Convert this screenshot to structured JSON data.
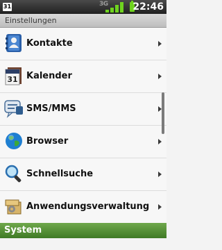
{
  "status_bar": {
    "calendar_day": "31",
    "network_type": "3G",
    "time": "22:46",
    "battery_color": "#6fd31f",
    "signal_color": "#6fd31f"
  },
  "header": {
    "title": "Einstellungen"
  },
  "settings": {
    "items": [
      {
        "label": "Kontakte",
        "icon": "contacts-icon"
      },
      {
        "label": "Kalender",
        "icon": "calendar-icon",
        "icon_text": "31"
      },
      {
        "label": "SMS/MMS",
        "icon": "messaging-icon"
      },
      {
        "label": "Browser",
        "icon": "globe-icon"
      },
      {
        "label": "Schnellsuche",
        "icon": "search-icon"
      },
      {
        "label": "Anwendungsverwaltung",
        "icon": "app-manager-icon"
      }
    ]
  },
  "section": {
    "title": "System",
    "color": "#4e8a30"
  }
}
